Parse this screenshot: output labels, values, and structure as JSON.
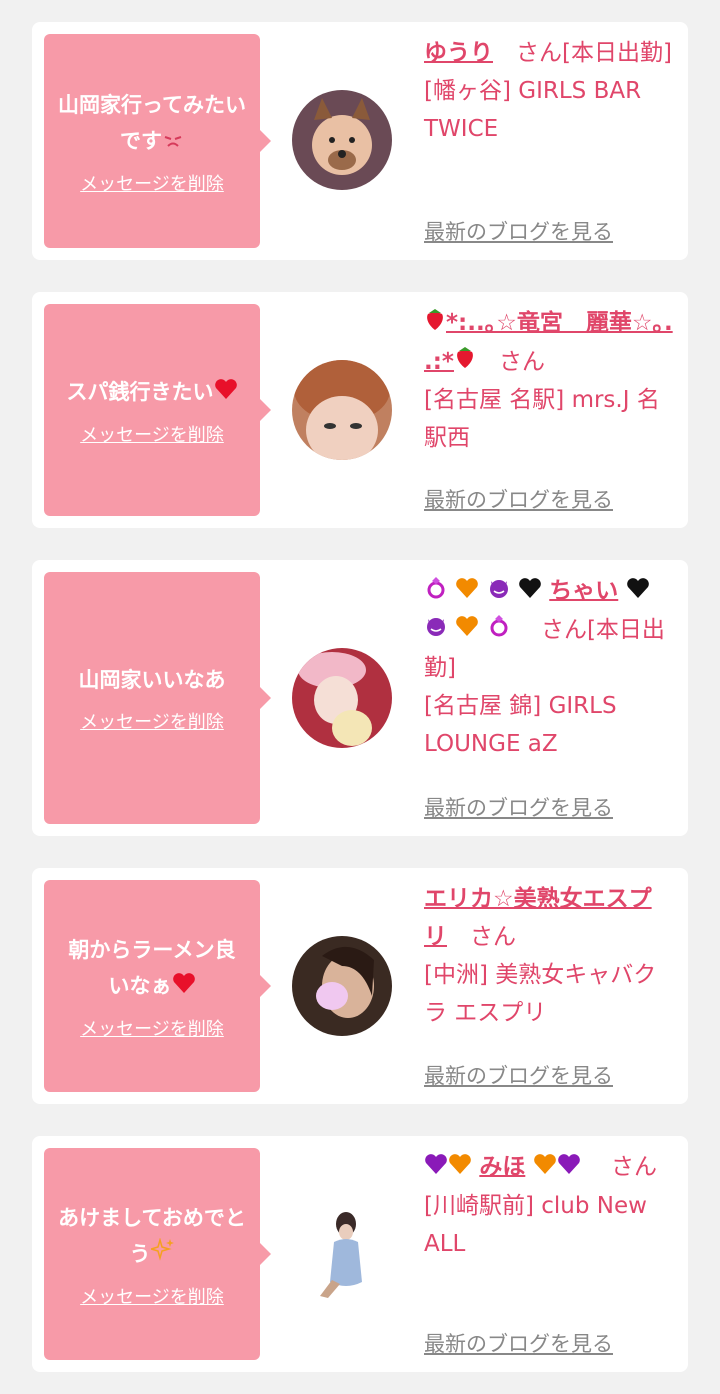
{
  "colors": {
    "page_bg": "#f1f1f1",
    "bubble_bg": "#f79aa8",
    "accent": "#e0466a",
    "muted": "#888888"
  },
  "delete_label": "メッセージを削除",
  "blog_label": "最新のブログを見る",
  "san_label": "さん",
  "cards": [
    {
      "message": "山岡家行ってみたいです",
      "message_emoji": "frowning-face-icon",
      "name": "ゆうり",
      "suffix": "さん[本日出勤]",
      "shop": "[幡ヶ谷] GIRLS BAR TWICE"
    },
    {
      "message": "スパ銭行きたい",
      "message_emoji": "heart-icon",
      "name": "*:..｡☆竜宮　麗華☆｡. .:*",
      "suffix": "さん",
      "shop": "[名古屋 名駅] mrs.J 名駅西"
    },
    {
      "message": "山岡家いいなあ",
      "name": "ちゃい",
      "suffix": "さん[本日出勤]",
      "shop": "[名古屋 錦] GIRLS LOUNGE aZ"
    },
    {
      "message": "朝からラーメン良いなぁ",
      "name": "エリカ☆美熟女エスプリ",
      "suffix": "さん",
      "shop": "[中洲] 美熟女キャバクラ エスプリ"
    },
    {
      "message": "あけましておめでとう",
      "name": "みほ",
      "suffix": "さん",
      "shop": "[川崎駅前] club New ALL"
    }
  ]
}
